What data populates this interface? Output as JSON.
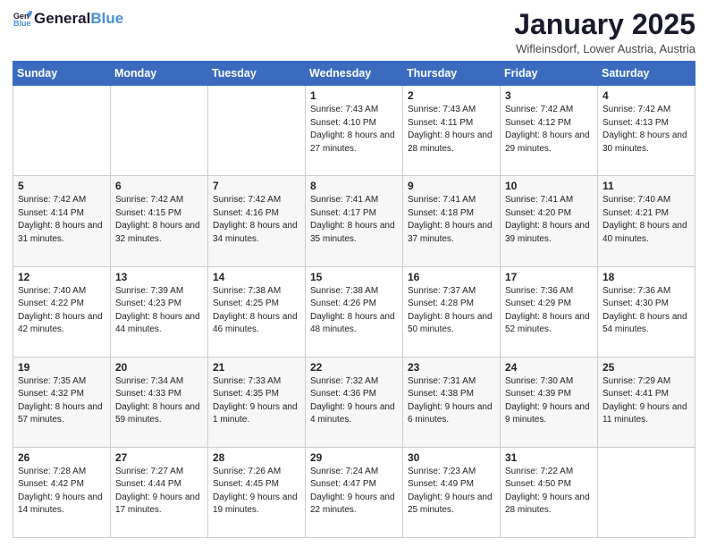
{
  "header": {
    "logo_text_general": "General",
    "logo_text_blue": "Blue",
    "month_title": "January 2025",
    "location": "Wifleinsdorf, Lower Austria, Austria"
  },
  "calendar": {
    "headers": [
      "Sunday",
      "Monday",
      "Tuesday",
      "Wednesday",
      "Thursday",
      "Friday",
      "Saturday"
    ],
    "weeks": [
      [
        {
          "day": "",
          "info": ""
        },
        {
          "day": "",
          "info": ""
        },
        {
          "day": "",
          "info": ""
        },
        {
          "day": "1",
          "info": "Sunrise: 7:43 AM\nSunset: 4:10 PM\nDaylight: 8 hours and 27 minutes."
        },
        {
          "day": "2",
          "info": "Sunrise: 7:43 AM\nSunset: 4:11 PM\nDaylight: 8 hours and 28 minutes."
        },
        {
          "day": "3",
          "info": "Sunrise: 7:42 AM\nSunset: 4:12 PM\nDaylight: 8 hours and 29 minutes."
        },
        {
          "day": "4",
          "info": "Sunrise: 7:42 AM\nSunset: 4:13 PM\nDaylight: 8 hours and 30 minutes."
        }
      ],
      [
        {
          "day": "5",
          "info": "Sunrise: 7:42 AM\nSunset: 4:14 PM\nDaylight: 8 hours and 31 minutes."
        },
        {
          "day": "6",
          "info": "Sunrise: 7:42 AM\nSunset: 4:15 PM\nDaylight: 8 hours and 32 minutes."
        },
        {
          "day": "7",
          "info": "Sunrise: 7:42 AM\nSunset: 4:16 PM\nDaylight: 8 hours and 34 minutes."
        },
        {
          "day": "8",
          "info": "Sunrise: 7:41 AM\nSunset: 4:17 PM\nDaylight: 8 hours and 35 minutes."
        },
        {
          "day": "9",
          "info": "Sunrise: 7:41 AM\nSunset: 4:18 PM\nDaylight: 8 hours and 37 minutes."
        },
        {
          "day": "10",
          "info": "Sunrise: 7:41 AM\nSunset: 4:20 PM\nDaylight: 8 hours and 39 minutes."
        },
        {
          "day": "11",
          "info": "Sunrise: 7:40 AM\nSunset: 4:21 PM\nDaylight: 8 hours and 40 minutes."
        }
      ],
      [
        {
          "day": "12",
          "info": "Sunrise: 7:40 AM\nSunset: 4:22 PM\nDaylight: 8 hours and 42 minutes."
        },
        {
          "day": "13",
          "info": "Sunrise: 7:39 AM\nSunset: 4:23 PM\nDaylight: 8 hours and 44 minutes."
        },
        {
          "day": "14",
          "info": "Sunrise: 7:38 AM\nSunset: 4:25 PM\nDaylight: 8 hours and 46 minutes."
        },
        {
          "day": "15",
          "info": "Sunrise: 7:38 AM\nSunset: 4:26 PM\nDaylight: 8 hours and 48 minutes."
        },
        {
          "day": "16",
          "info": "Sunrise: 7:37 AM\nSunset: 4:28 PM\nDaylight: 8 hours and 50 minutes."
        },
        {
          "day": "17",
          "info": "Sunrise: 7:36 AM\nSunset: 4:29 PM\nDaylight: 8 hours and 52 minutes."
        },
        {
          "day": "18",
          "info": "Sunrise: 7:36 AM\nSunset: 4:30 PM\nDaylight: 8 hours and 54 minutes."
        }
      ],
      [
        {
          "day": "19",
          "info": "Sunrise: 7:35 AM\nSunset: 4:32 PM\nDaylight: 8 hours and 57 minutes."
        },
        {
          "day": "20",
          "info": "Sunrise: 7:34 AM\nSunset: 4:33 PM\nDaylight: 8 hours and 59 minutes."
        },
        {
          "day": "21",
          "info": "Sunrise: 7:33 AM\nSunset: 4:35 PM\nDaylight: 9 hours and 1 minute."
        },
        {
          "day": "22",
          "info": "Sunrise: 7:32 AM\nSunset: 4:36 PM\nDaylight: 9 hours and 4 minutes."
        },
        {
          "day": "23",
          "info": "Sunrise: 7:31 AM\nSunset: 4:38 PM\nDaylight: 9 hours and 6 minutes."
        },
        {
          "day": "24",
          "info": "Sunrise: 7:30 AM\nSunset: 4:39 PM\nDaylight: 9 hours and 9 minutes."
        },
        {
          "day": "25",
          "info": "Sunrise: 7:29 AM\nSunset: 4:41 PM\nDaylight: 9 hours and 11 minutes."
        }
      ],
      [
        {
          "day": "26",
          "info": "Sunrise: 7:28 AM\nSunset: 4:42 PM\nDaylight: 9 hours and 14 minutes."
        },
        {
          "day": "27",
          "info": "Sunrise: 7:27 AM\nSunset: 4:44 PM\nDaylight: 9 hours and 17 minutes."
        },
        {
          "day": "28",
          "info": "Sunrise: 7:26 AM\nSunset: 4:45 PM\nDaylight: 9 hours and 19 minutes."
        },
        {
          "day": "29",
          "info": "Sunrise: 7:24 AM\nSunset: 4:47 PM\nDaylight: 9 hours and 22 minutes."
        },
        {
          "day": "30",
          "info": "Sunrise: 7:23 AM\nSunset: 4:49 PM\nDaylight: 9 hours and 25 minutes."
        },
        {
          "day": "31",
          "info": "Sunrise: 7:22 AM\nSunset: 4:50 PM\nDaylight: 9 hours and 28 minutes."
        },
        {
          "day": "",
          "info": ""
        }
      ]
    ]
  }
}
